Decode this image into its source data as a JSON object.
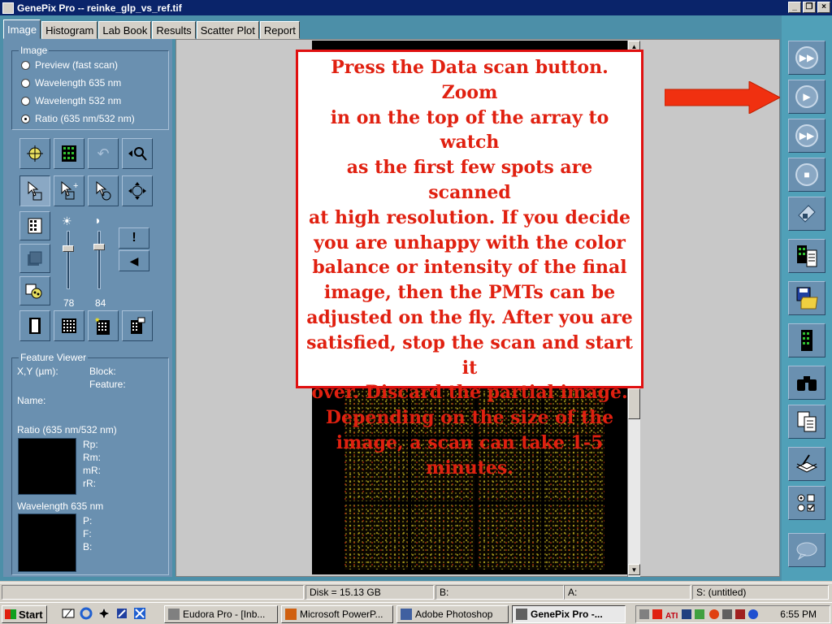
{
  "window": {
    "title": "GenePix Pro -- reinke_glp_vs_ref.tif",
    "controls": [
      "_",
      "❐",
      "×"
    ]
  },
  "tabs": [
    {
      "label": "Image",
      "active": true
    },
    {
      "label": "Histogram"
    },
    {
      "label": "Lab Book"
    },
    {
      "label": "Results"
    },
    {
      "label": "Scatter Plot"
    },
    {
      "label": "Report"
    }
  ],
  "image_group": {
    "title": "Image",
    "options": [
      {
        "label": "Preview  (fast scan)",
        "selected": false
      },
      {
        "label": "Wavelength 635 nm",
        "selected": false
      },
      {
        "label": "Wavelength 532 nm",
        "selected": false
      },
      {
        "label": "Ratio (635 nm/532 nm)",
        "selected": true
      }
    ]
  },
  "sliders": {
    "brightness_value": "78",
    "contrast_value": "84"
  },
  "feature_viewer": {
    "title": "Feature Viewer",
    "xy_label": "X,Y (µm):",
    "block_label": "Block:",
    "feature_label": "Feature:",
    "name_label": "Name:",
    "ratio_title": "Ratio (635 nm/532 nm)",
    "ratio_fields": [
      "Rp:",
      "Rm:",
      "mR:",
      "rR:"
    ],
    "wavelength_title": "Wavelength 635 nm",
    "wavelength_fields": [
      "P:",
      "F:",
      "B:"
    ]
  },
  "callout": {
    "lines": [
      "Press the Data scan button.  Zoom",
      "in on the top of the array to watch",
      "as the first few spots are scanned",
      "at high resolution.  If you decide",
      "you are unhappy with the color",
      "balance or intensity of the final",
      "image, then the PMTs can be",
      "adjusted on the fly.  After you are",
      "satisfied, stop the scan and start it",
      "over.  Discard the partial image.",
      "Depending on the size of the",
      "image, a scan can take 1-5",
      "minutes."
    ],
    "color": "#e02010"
  },
  "status": {
    "disk": "Disk = 15.13 GB",
    "b": "B:",
    "a": "A:",
    "s": "S: (untitled)"
  },
  "taskbar": {
    "start_label": "Start",
    "tasks": [
      {
        "label": "Eudora Pro - [Inb..."
      },
      {
        "label": "Microsoft PowerP..."
      },
      {
        "label": "Adobe Photoshop"
      },
      {
        "label": "GenePix Pro -...",
        "active": true
      }
    ],
    "clock": "6:55 PM"
  }
}
